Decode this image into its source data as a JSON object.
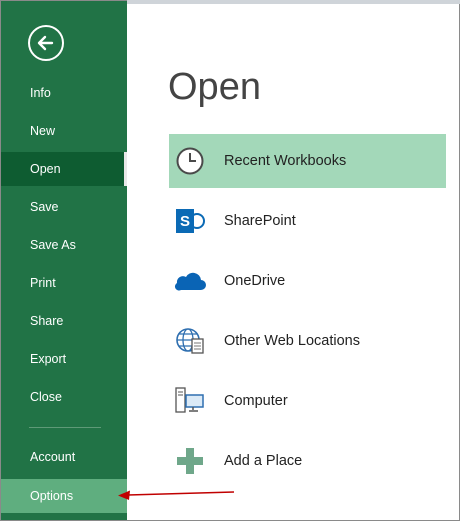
{
  "sidebar": {
    "items": [
      {
        "label": "Info"
      },
      {
        "label": "New"
      },
      {
        "label": "Open"
      },
      {
        "label": "Save"
      },
      {
        "label": "Save As"
      },
      {
        "label": "Print"
      },
      {
        "label": "Share"
      },
      {
        "label": "Export"
      },
      {
        "label": "Close"
      },
      {
        "label": "Account"
      },
      {
        "label": "Options"
      }
    ],
    "selected": "Open",
    "highlighted": "Options"
  },
  "main": {
    "title": "Open",
    "locations": [
      {
        "label": "Recent Workbooks",
        "icon": "clock-icon",
        "selected": true
      },
      {
        "label": "SharePoint",
        "icon": "sharepoint-icon"
      },
      {
        "label": "OneDrive",
        "icon": "onedrive-icon"
      },
      {
        "label": "Other Web Locations",
        "icon": "globe-icon"
      },
      {
        "label": "Computer",
        "icon": "computer-icon"
      },
      {
        "label": "Add a Place",
        "icon": "plus-icon"
      }
    ]
  },
  "colors": {
    "sidebar": "#217346",
    "selected_nav": "#0e5c31",
    "selected_location": "#a3d8b9",
    "annotation_arrow": "#c00000"
  }
}
